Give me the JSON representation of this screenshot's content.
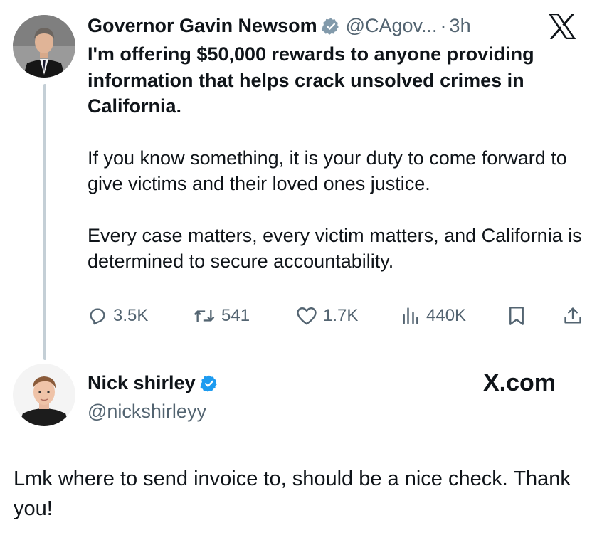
{
  "original_tweet": {
    "author": {
      "display_name": "Governor Gavin Newsom",
      "verified_badge": "gray-verified-icon",
      "handle": "@CAgov...",
      "separator": "·",
      "time_ago": "3h"
    },
    "platform_icon": "x-logo-icon",
    "paragraphs": [
      "I'm offering $50,000 rewards to anyone providing information that helps crack unsolved crimes in California.",
      "If you know something, it is your duty to come forward to give victims and their loved ones justice.",
      "Every case matters, every victim matters, and California is determined to secure accountability."
    ],
    "actions": {
      "replies": "3.5K",
      "reposts": "541",
      "likes": "1.7K",
      "views": "440K"
    }
  },
  "reply_tweet": {
    "author": {
      "display_name": "Nick shirley",
      "verified_badge": "blue-verified-icon",
      "handle": "@nickshirleyy"
    },
    "watermark": "X.com",
    "text": "Lmk where to send invoice to, should be a nice check. Thank you!"
  },
  "colors": {
    "text": "#0f1419",
    "secondary": "#536471",
    "verified_blue": "#1d9bf0",
    "verified_gray": "#829aab",
    "thread_line": "#c4cfd6"
  }
}
